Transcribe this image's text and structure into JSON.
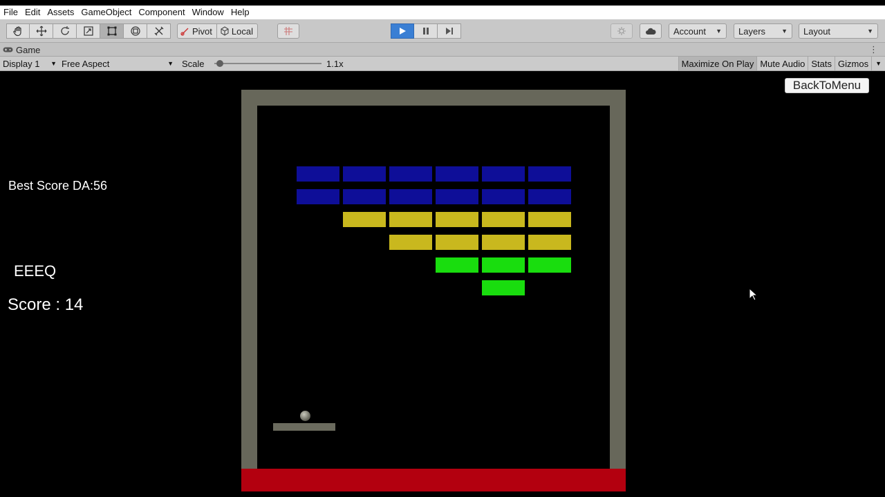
{
  "menu": [
    "File",
    "Edit",
    "Assets",
    "GameObject",
    "Component",
    "Window",
    "Help"
  ],
  "toolbar": {
    "tools": [
      "hand-icon",
      "move-icon",
      "rotate-icon",
      "scale-icon",
      "rect-tool-icon",
      "transform-icon",
      "custom-tool-icon"
    ],
    "pivot_label": "Pivot",
    "local_label": "Local",
    "account_label": "Account",
    "layers_label": "Layers",
    "layout_label": "Layout"
  },
  "tab": {
    "label": "Game"
  },
  "game_toolbar": {
    "display": "Display 1",
    "aspect": "Free Aspect",
    "scale_label": "Scale",
    "scale_value": "1.1x",
    "scale_fraction": 0.05,
    "maximize": "Maximize On Play",
    "mute": "Mute Audio",
    "stats": "Stats",
    "gizmos": "Gizmos"
  },
  "game": {
    "best_score": "Best Score DA:56",
    "player_name": "EEEQ",
    "score": "Score : 14",
    "back_button": "BackToMenu",
    "colors": {
      "wall": "#67675a",
      "floor": "#b3000f",
      "blue": "#0e0e98",
      "yellow": "#c9b81e",
      "green": "#19dd0e"
    },
    "brick_rows": [
      {
        "color": "blue",
        "columns": [
          1,
          2,
          3,
          4,
          5,
          6
        ]
      },
      {
        "color": "blue",
        "columns": [
          1,
          2,
          3,
          4,
          5,
          6
        ]
      },
      {
        "color": "yellow",
        "columns": [
          2,
          3,
          4,
          5,
          6
        ]
      },
      {
        "color": "yellow",
        "columns": [
          3,
          4,
          5,
          6
        ]
      },
      {
        "color": "green",
        "columns": [
          4,
          5,
          6
        ]
      },
      {
        "color": "green",
        "columns": [
          5
        ]
      }
    ]
  }
}
